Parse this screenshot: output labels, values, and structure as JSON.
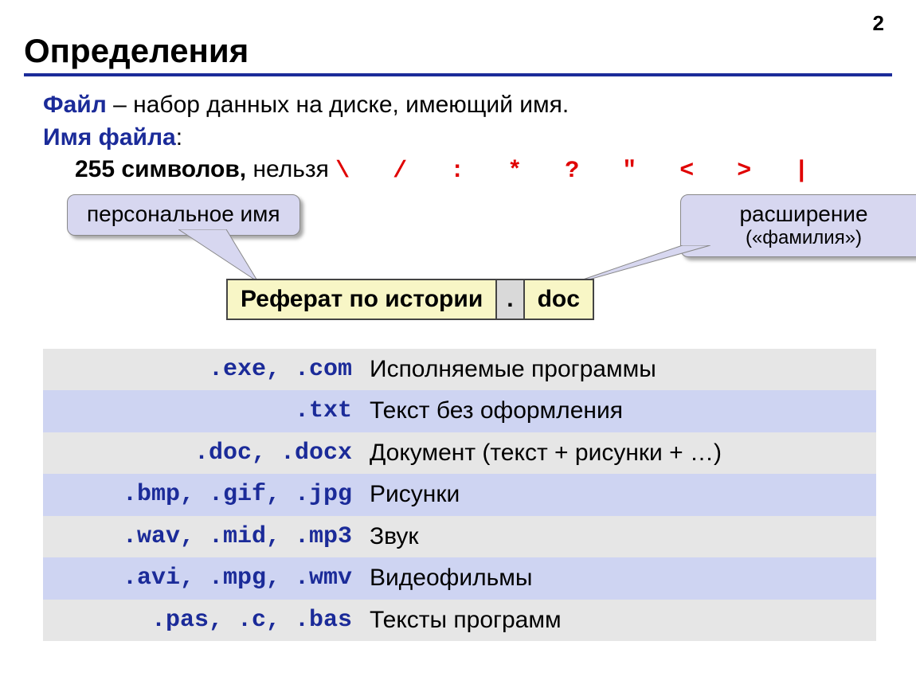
{
  "page_number": "2",
  "title": "Определения",
  "def_line": {
    "term": "Файл",
    "sep": " – ",
    "text": "набор данных на диске, имеющий имя."
  },
  "name_line": {
    "term": "Имя файла",
    "colon": ":"
  },
  "rule_line": {
    "bold": "255 символов,",
    "plain": " нельзя ",
    "forbidden": "\\ / : * ? ″ < > |"
  },
  "callout_left": "персональное имя",
  "callout_right": {
    "title": "расширение",
    "sub": "(«фамилия»)"
  },
  "filename": {
    "base": "Реферат по истории",
    "dot": ".",
    "ext": "doc"
  },
  "ext_rows": [
    {
      "ext": ".exe, .com",
      "desc": "Исполняемые программы"
    },
    {
      "ext": ".txt",
      "desc": "Текст без оформления"
    },
    {
      "ext": ".doc, .docx",
      "desc": "Документ (текст + рисунки + …)"
    },
    {
      "ext": ".bmp, .gif, .jpg",
      "desc": "Рисунки"
    },
    {
      "ext": ".wav, .mid, .mp3",
      "desc": "Звук"
    },
    {
      "ext": ".avi, .mpg, .wmv",
      "desc": "Видеофильмы"
    },
    {
      "ext": ".pas, .c, .bas",
      "desc": "Тексты программ"
    }
  ]
}
